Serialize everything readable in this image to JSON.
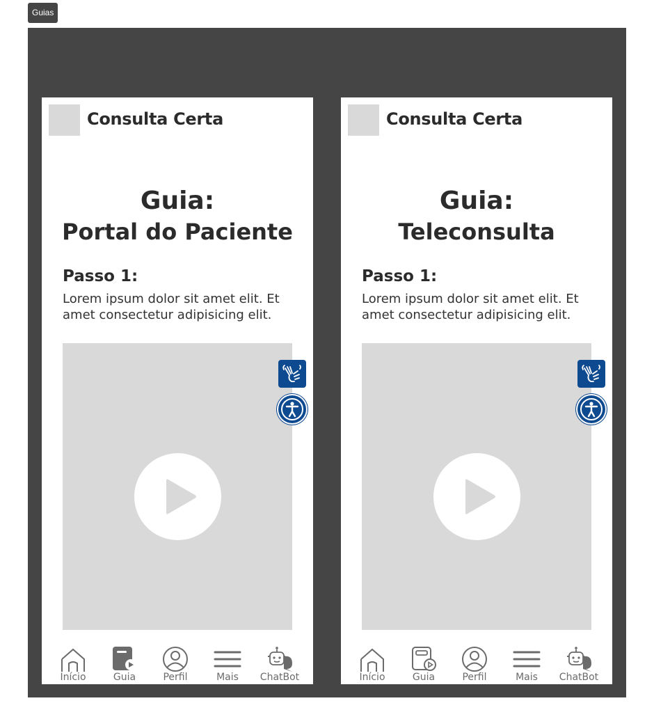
{
  "frame_label": "Guias",
  "screens": [
    {
      "app_name": "Consulta Certa",
      "guide_title": "Guia:",
      "guide_subtitle": "Portal do Paciente",
      "step_title": "Passo 1:",
      "step_text": "Lorem ipsum dolor sit amet elit. Et amet consectetur adipisicing elit.",
      "nav": [
        "Início",
        "Guia",
        "Perfil",
        "Mais",
        "ChatBot"
      ]
    },
    {
      "app_name": "Consulta Certa",
      "guide_title": "Guia:",
      "guide_subtitle": "Teleconsulta",
      "step_title": "Passo 1:",
      "step_text": "Lorem ipsum dolor sit amet elit. Et amet consectetur adipisicing elit.",
      "nav": [
        "Início",
        "Guia",
        "Perfil",
        "Mais",
        "ChatBot"
      ]
    }
  ],
  "icons": {
    "play": "play-icon",
    "libras": "sign-language-icon",
    "accessibility": "accessibility-icon",
    "home": "home-icon",
    "guide": "guide-icon",
    "profile": "profile-icon",
    "menu": "menu-icon",
    "chatbot": "chatbot-icon"
  },
  "colors": {
    "board": "#454545",
    "placeholder": "#d9d9d9",
    "accent": "#0d4a8f",
    "nav_icon": "#6b6b6b"
  }
}
